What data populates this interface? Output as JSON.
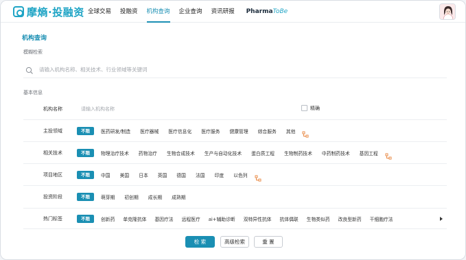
{
  "brand": {
    "name": "摩熵·投融资"
  },
  "nav": {
    "items": [
      "全球交易",
      "投融资",
      "机构查询",
      "企业查询",
      "资讯研报"
    ],
    "active_index": 2,
    "pharma_prefix": "Pharma",
    "pharma_suffix": "ToBe"
  },
  "page": {
    "title": "机构查询",
    "fuzzy_section": "模糊检索",
    "search_placeholder": "请输入机构名称、相关技术、行业领域等关键词",
    "basic_section": "基本信息"
  },
  "filters": {
    "name": {
      "label": "机构名称",
      "placeholder": "请输入机构名称",
      "exact_label": "精确"
    },
    "invest_field": {
      "label": "主投领域",
      "all": "不限",
      "options": [
        "医药研发/制造",
        "医疗器械",
        "医疗信息化",
        "医疗服务",
        "健康管理",
        "综合服务",
        "其他"
      ]
    },
    "technology": {
      "label": "相关技术",
      "all": "不限",
      "options": [
        "物理治疗技术",
        "药物治疗",
        "生物合成技术",
        "生产与自动化技术",
        "蛋白质工程",
        "生物制药技术",
        "中药制药技术",
        "基因工程"
      ]
    },
    "region": {
      "label": "项目地区",
      "all": "不限",
      "options": [
        "中国",
        "美国",
        "日本",
        "英国",
        "德国",
        "法国",
        "印度",
        "以色列"
      ]
    },
    "stage": {
      "label": "投资阶段",
      "all": "不限",
      "options": [
        "萌芽期",
        "初创期",
        "成长期",
        "成熟期"
      ]
    },
    "tags": {
      "label": "热门标签",
      "all": "不限",
      "options": [
        "创新药",
        "单克隆抗体",
        "基因疗法",
        "远程医疗",
        "ai+辅助诊断",
        "双特异性抗体",
        "抗体偶联",
        "生物类似药",
        "改良型新药",
        "干细胞疗法"
      ]
    }
  },
  "buttons": {
    "search": "检 索",
    "advanced": "高级检索",
    "reset": "重 置"
  },
  "colors": {
    "accent": "#1a8fb3",
    "logo": "#1ea4c5",
    "plus": "#e8833a"
  }
}
